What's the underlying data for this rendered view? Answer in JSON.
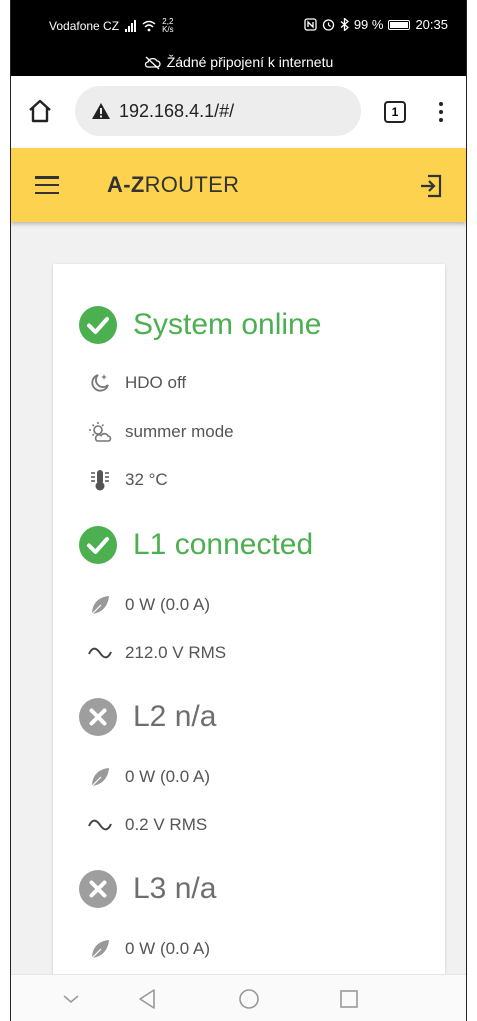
{
  "status_bar": {
    "carrier": "Vodafone CZ",
    "speed_value": "2,2",
    "speed_unit": "K/s",
    "battery": "99 %",
    "time": "20:35",
    "notice": "Žádné připojení k internetu"
  },
  "browser": {
    "url": "192.168.4.1/#/",
    "tab_count": "1"
  },
  "app": {
    "brand_part1": "A-",
    "brand_part2": "Z",
    "brand_part3": "ROUTER",
    "brand_color": "#fdd24f"
  },
  "status": {
    "system": {
      "title": "System online",
      "state": "ok"
    },
    "hdo": "HDO off",
    "mode": "summer mode",
    "temperature": "32 °C",
    "phases": [
      {
        "title": "L1 connected",
        "state": "ok",
        "power": "0 W (0.0 A)",
        "voltage": "212.0 V RMS"
      },
      {
        "title": "L2 n/a",
        "state": "na",
        "power": "0 W (0.0 A)",
        "voltage": "0.2 V RMS"
      },
      {
        "title": "L3 n/a",
        "state": "na",
        "power": "0 W (0.0 A)"
      }
    ]
  },
  "colors": {
    "ok": "#4caf50",
    "na": "#9e9e9e"
  }
}
